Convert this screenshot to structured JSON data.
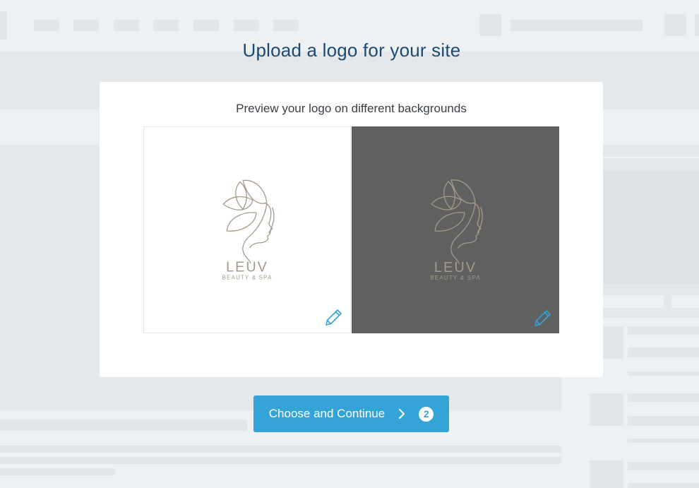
{
  "page": {
    "title": "Upload a logo for your site"
  },
  "preview": {
    "subtitle": "Preview your logo on different backgrounds",
    "logo_name": "LEUV",
    "logo_tagline": "BEAUTY & SPA",
    "panels": [
      {
        "background": "light",
        "color": "#ffffff",
        "edit_icon": "pencil-icon"
      },
      {
        "background": "dark",
        "color": "#606060",
        "edit_icon": "pencil-icon"
      }
    ]
  },
  "cta": {
    "label": "Choose and Continue",
    "icon": "chevron-right-icon",
    "step": "2",
    "color": "#33a3d8"
  },
  "colors": {
    "title": "#1d4a73",
    "logo": "#a69a89",
    "icon": "#33a3d8"
  }
}
